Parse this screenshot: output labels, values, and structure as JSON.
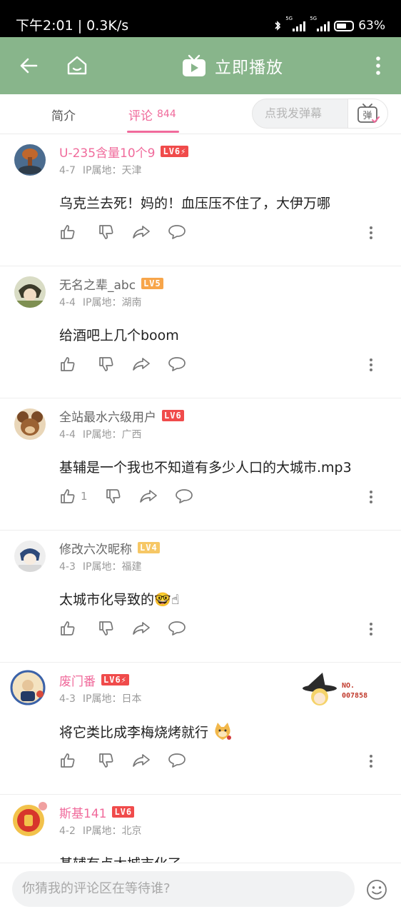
{
  "status_bar": {
    "time_speed": "下午2:01 | 0.3K/s",
    "network_a": "5G",
    "network_b": "5G",
    "battery_text": "63%",
    "battery_level": 0.63
  },
  "title_bar": {
    "play_label": "立即播放",
    "icons": [
      "back-arrow-icon",
      "home-tv-icon",
      "tv-play-icon",
      "more-vertical-icon"
    ]
  },
  "tabs": {
    "intro_label": "简介",
    "comments_label": "评论",
    "comments_count": "844",
    "danmaku_placeholder": "点我发弹幕",
    "danmaku_button_label": "弹"
  },
  "comments": [
    {
      "username": "U-235含量10个9",
      "level": "LV6⚡",
      "vip": true,
      "date": "4-7",
      "ip": "IP属地：天津",
      "text": "乌克兰去死！妈的！血压压不住了，大伊万哪",
      "likes": ""
    },
    {
      "username": "无名之辈_abc",
      "level": "LV5",
      "vip": false,
      "date": "4-4",
      "ip": "IP属地：湖南",
      "text": "给酒吧上几个boom",
      "likes": ""
    },
    {
      "username": "全站最水六级用户",
      "level": "LV6",
      "vip": false,
      "date": "4-4",
      "ip": "IP属地：广西",
      "text": "基辅是一个我也不知道有多少人口的大城市.mp3",
      "likes": "1"
    },
    {
      "username": "修改六次昵称",
      "level": "LV4",
      "vip": false,
      "date": "4-3",
      "ip": "IP属地：福建",
      "text": "太城市化导致的🤓☝",
      "likes": ""
    },
    {
      "username": "废门番",
      "level": "LV6⚡",
      "vip": true,
      "date": "4-3",
      "ip": "IP属地：日本",
      "text": "将它类比成李梅烧烤就行",
      "likes": "",
      "decoration_no": "NO.",
      "decoration_num": "007858"
    },
    {
      "username": "斯基141",
      "level": "LV6",
      "vip": true,
      "date": "4-2",
      "ip": "IP属地：北京",
      "text": "基辅有点太城市化了",
      "likes": ""
    }
  ],
  "colors": {
    "title_bar": "#88b58b",
    "accent_pink": "#f06a9b",
    "level_red": "#f04b4b",
    "level_orange": "#f7a54a",
    "level_yellow": "#f6c765"
  },
  "bottom_bar": {
    "reply_placeholder": "你猜我的评论区在等待谁?",
    "emoji_icon": "smiley-icon"
  }
}
